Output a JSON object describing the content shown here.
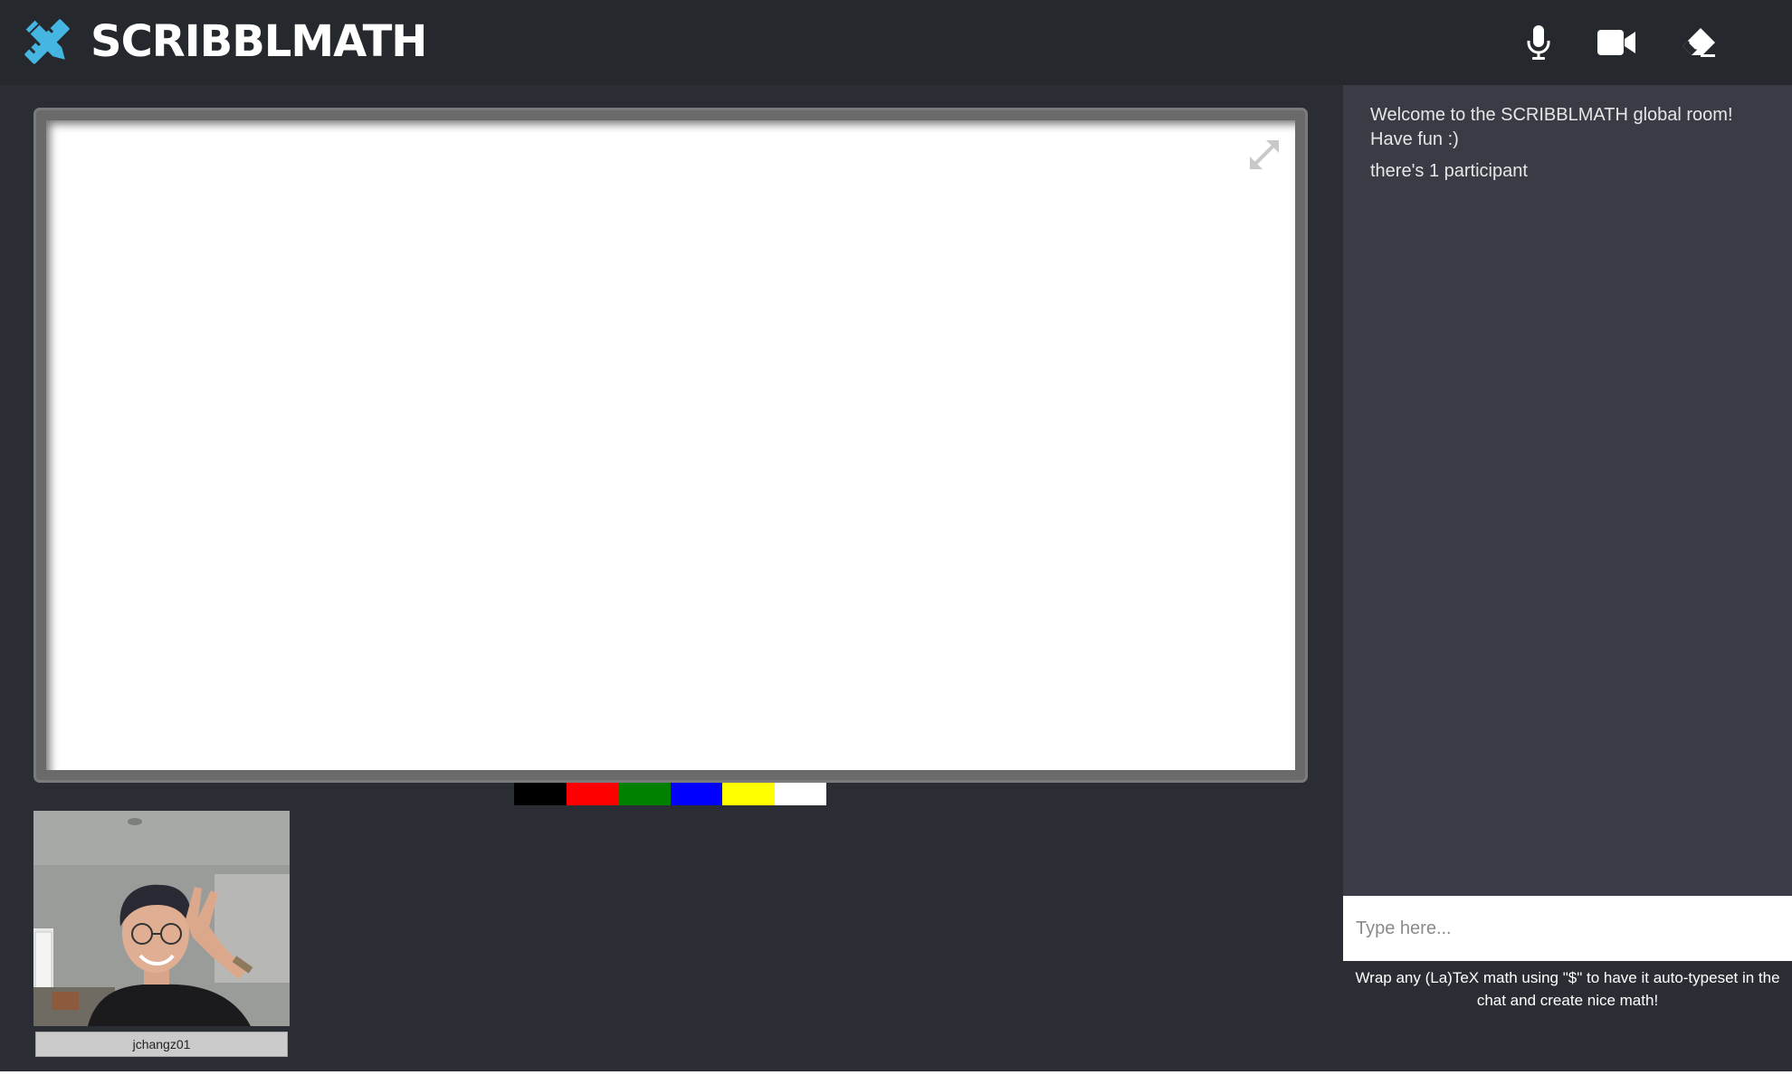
{
  "app": {
    "name": "SCRIBBLMATH",
    "logo_icon": "pencil-ruler-icon",
    "accent_color": "#45b5e2"
  },
  "toolbar": {
    "buttons": [
      {
        "name": "microphone",
        "icon": "microphone-icon"
      },
      {
        "name": "camera",
        "icon": "video-camera-icon"
      },
      {
        "name": "eraser",
        "icon": "eraser-icon"
      }
    ]
  },
  "whiteboard": {
    "expand_icon": "expand-icon",
    "palette": [
      "#000000",
      "#ff0000",
      "#008000",
      "#0000ff",
      "#ffff00",
      "#ffffff"
    ]
  },
  "participants": [
    {
      "username": "jchangz01"
    }
  ],
  "chat": {
    "messages": [
      "Welcome to the SCRIBBLMATH global room! Have fun :)",
      "there's 1 participant"
    ],
    "input_placeholder": "Type here...",
    "help_text": "Wrap any (La)TeX math using \"$\" to have it auto-typeset in the chat and create nice math!"
  }
}
